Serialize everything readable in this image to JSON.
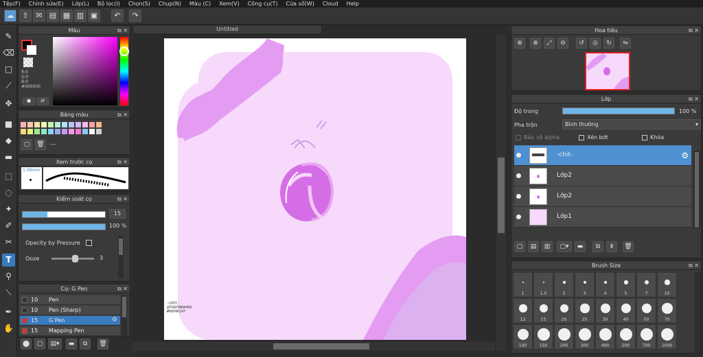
{
  "menu": [
    "Tệp(F)",
    "Chỉnh sửa(E)",
    "Lớp(L)",
    "Bộ lọc(I)",
    "Chọn(S)",
    "Chụp(N)",
    "Màu (C)",
    "Xem(V)",
    "Công cụ(T)",
    "Cửa sổ(W)",
    "Cloud",
    "Help"
  ],
  "panels": {
    "color": {
      "title": "Màu",
      "rgb": [
        "R:0",
        "G:0",
        "B:0"
      ],
      "hex": "#000000"
    },
    "palette": {
      "title": "Bảng màu",
      "name": "---",
      "swatches": [
        "#f7b6b6",
        "#f5c9a6",
        "#f7e2a8",
        "#f0f7b0",
        "#c8f0b0",
        "#b0f0d8",
        "#b0e4f7",
        "#b9c4f7",
        "#d6b9f7",
        "#f7b9ea",
        "#f4a3a3",
        "#f4b98a",
        "#f7d97a",
        "#e8f27a",
        "#a4e88a",
        "#8ae8c4",
        "#8ad2f4",
        "#9aaaf4",
        "#c49af4",
        "#f49ae0",
        "#f07ad0",
        "#8ac6f7",
        "#f7f7f7",
        "#cfcfcf"
      ]
    },
    "brush_preview": {
      "title": "Xem trước cọ",
      "size": "1.09mm"
    },
    "brush_control": {
      "title": "Kiểm soát cọ",
      "size_value": "15",
      "opacity_value": "100 %",
      "opacity_pressure": "Opacity by Pressure",
      "ooze_label": "Ooze",
      "ooze_value": "3",
      "size_fill": 0.3,
      "opacity_fill": 1.0,
      "ooze_fill": 0.55
    },
    "brush_list": {
      "title": "Cọ: G Pen",
      "items": [
        {
          "size": "10",
          "name": "Pen",
          "color": "#333333"
        },
        {
          "size": "10",
          "name": "Pen (Sharp)",
          "color": "#333333"
        },
        {
          "size": "15",
          "name": "G Pen",
          "color": "#e03030"
        },
        {
          "size": "15",
          "name": "Mapping Pen",
          "color": "#e03030"
        }
      ]
    }
  },
  "document": {
    "tab": "Untitled",
    "signature": [
      "-CHIT-",
      "@TUQUYNHA408",
      "#HOPAP247"
    ]
  },
  "navigator": {
    "title": "Hoa tiêu"
  },
  "layers": {
    "title": "Lớp",
    "opacity_label": "Độ trong",
    "opacity_value": "100 %",
    "opacity_fill": 1.0,
    "blend_label": "Pha trộn",
    "blend_value": "Bình thường",
    "protect_alpha": "Bảo vệ alpha",
    "clipping": "Xén bớt",
    "lock": "Khóa",
    "items": [
      {
        "name": "-chit-",
        "selected": true
      },
      {
        "name": "Lớp2",
        "selected": false
      },
      {
        "name": "Lớp2",
        "selected": false
      },
      {
        "name": "Lớp1",
        "selected": false
      }
    ]
  },
  "brush_size": {
    "title": "Brush Size",
    "sizes": [
      "1",
      "1.5",
      "2",
      "3",
      "4",
      "5",
      "7",
      "10",
      "12",
      "15",
      "20",
      "25",
      "30",
      "40",
      "50",
      "70",
      "100",
      "150",
      "200",
      "300",
      "400",
      "500",
      "700",
      "1000"
    ]
  },
  "colors": {
    "accent": "#4e90d0",
    "canvas_pink": "#f7d9fb",
    "blob_pink": "#e49cf2"
  }
}
